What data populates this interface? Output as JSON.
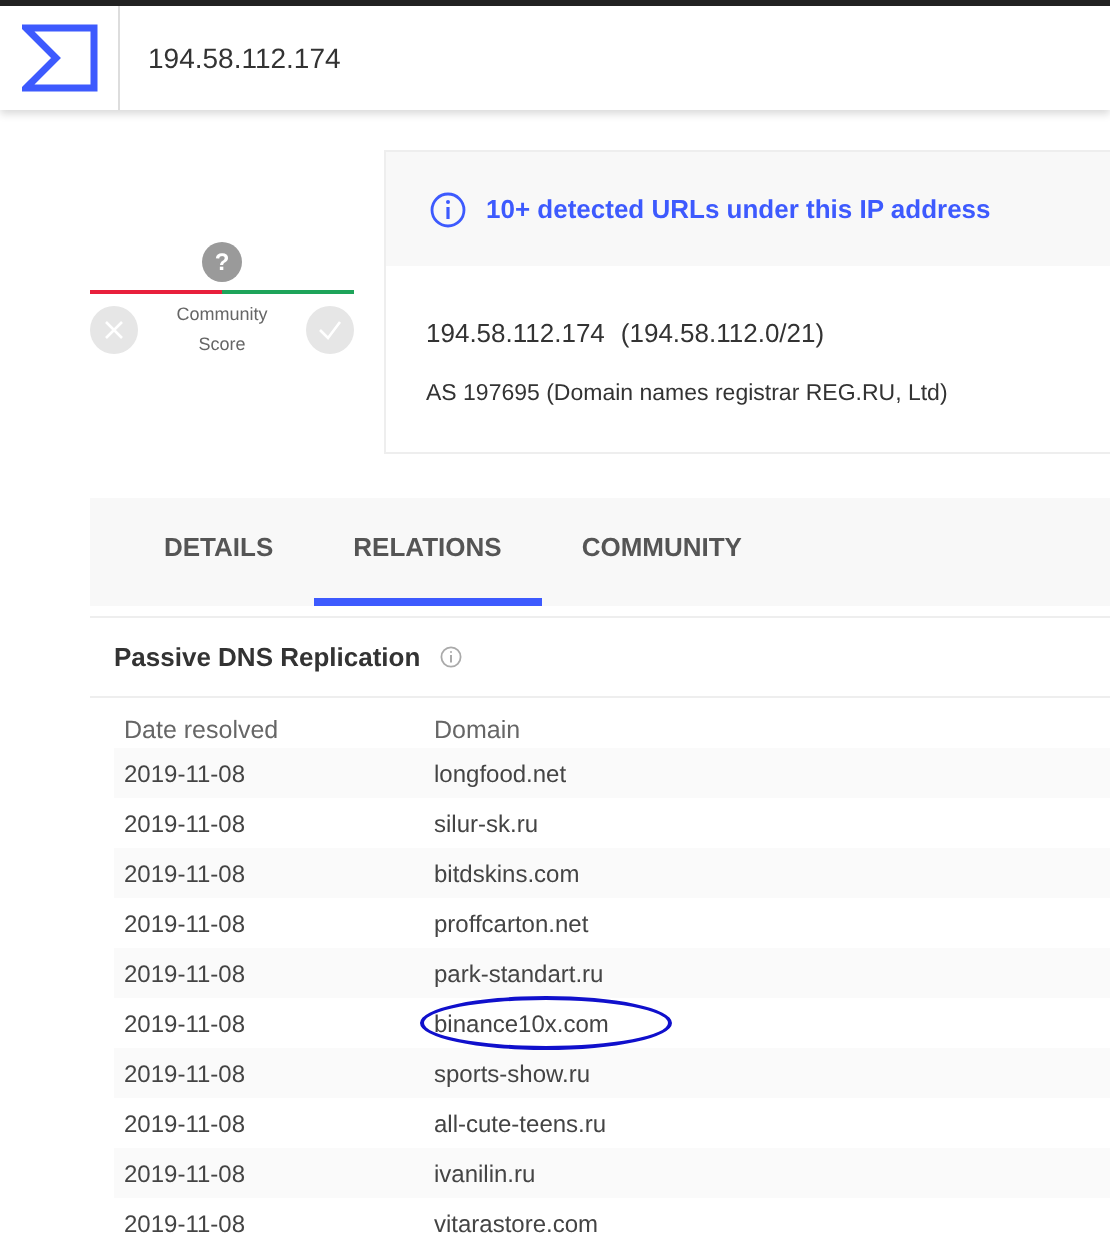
{
  "search": {
    "value": "194.58.112.174"
  },
  "community_score": {
    "score": "?",
    "label": "Community Score"
  },
  "alert": {
    "text": "10+ detected URLs under this IP address"
  },
  "ip_info": {
    "ip": "194.58.112.174",
    "range": "(194.58.112.0/21)",
    "asn": "AS 197695 (Domain names registrar REG.RU, Ltd)"
  },
  "tabs": [
    {
      "label": "DETAILS",
      "selected": false
    },
    {
      "label": "RELATIONS",
      "selected": true
    },
    {
      "label": "COMMUNITY",
      "selected": false
    }
  ],
  "section": {
    "title": "Passive DNS Replication"
  },
  "table": {
    "columns": [
      "Date resolved",
      "Domain"
    ],
    "rows": [
      {
        "date": "2019-11-08",
        "domain": "longfood.net",
        "circled": false
      },
      {
        "date": "2019-11-08",
        "domain": "silur-sk.ru",
        "circled": false
      },
      {
        "date": "2019-11-08",
        "domain": "bitdskins.com",
        "circled": false
      },
      {
        "date": "2019-11-08",
        "domain": "proffcarton.net",
        "circled": false
      },
      {
        "date": "2019-11-08",
        "domain": "park-standart.ru",
        "circled": false
      },
      {
        "date": "2019-11-08",
        "domain": "binance10x.com",
        "circled": true
      },
      {
        "date": "2019-11-08",
        "domain": "sports-show.ru",
        "circled": false
      },
      {
        "date": "2019-11-08",
        "domain": "all-cute-teens.ru",
        "circled": false
      },
      {
        "date": "2019-11-08",
        "domain": "ivanilin.ru",
        "circled": false
      },
      {
        "date": "2019-11-08",
        "domain": "vitarastore.com",
        "circled": false
      }
    ]
  }
}
